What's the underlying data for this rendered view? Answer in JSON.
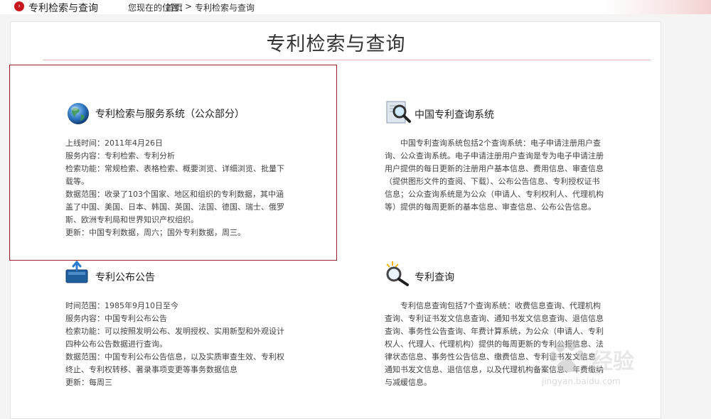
{
  "header": {
    "site_section": "专利检索与查询",
    "location_label": "您现在的位置：",
    "breadcrumb_home": "首页",
    "breadcrumb_sep": ">",
    "breadcrumb_current": "专利检索与查询"
  },
  "page": {
    "title": "专利检索与查询"
  },
  "cards": {
    "retrieval": {
      "title": "专利检索与服务系统（公众部分）",
      "lines": [
        "上线时间：2011年4月26日",
        "服务内容：专利检索、专利分析",
        "检索功能：常规检索、表格检索、概要浏览、详细浏览、批量下",
        "载等。",
        "数据范围：收录了103个国家、地区和组织的专利数据，其中涵",
        "盖了中国、美国、日本、韩国、英国、法国、德国、瑞士、俄罗",
        "斯、欧洲专利局和世界知识产权组织。",
        "更新：中国专利数据，周六；国外专利数据，周三。"
      ]
    },
    "china_query": {
      "title": "中国专利查询系统",
      "lines": [
        "中国专利查询系统包括2个查询系统：电子申请注册用户查",
        "询、公众查询系统。电子申请注册用户查询是专为电子申请注册",
        "用户提供的每日更新的注册用户基本信息、费用信息、审查信息",
        "（提供图形文件的查阅、下载）、公布公告信息、专利授权证书",
        "信息；公众查询系统是为公众（申请人、专利权利人、代理机构",
        "等）提供的每周更新的基本信息、审查信息、公布公告信息。"
      ]
    },
    "gazette": {
      "title": "专利公布公告",
      "lines": [
        "时间范围：1985年9月10日至今",
        "服务内容：中国专利公布公告",
        "检索功能：可以按照发明公布、发明授权、实用新型和外观设计",
        "四种公布公告数据进行查询。",
        "数据范围：中国专利公布公告信息，以及实质审查生效、专利权",
        "终止、专利权转移、著录事项变更等事务数据信息",
        "更新：每周三"
      ]
    },
    "query": {
      "title": "专利查询",
      "lines": [
        "专利信息查询包括7个查询系统：收费信息查询、代理机构",
        "查询、专利证书发文信息查询、通知书发文信息查询、退信信息",
        "查询、事务性公告查询、年费计算系统，为公众（申请人、专利",
        "权人、代理人、代理机构）提供的每周更新的专利公报信息、法",
        "律状态信息、事务性公告信息、缴费信息、专利证书发文信息",
        "通知书发文信息、退信信息，以及代理机构备案信息、年费缴纳",
        "与减缓信息。"
      ]
    }
  },
  "watermark": {
    "brand": "经验",
    "url": "jingyan.baidu.com"
  },
  "icons": {
    "globe": "globe-icon",
    "magnifier_doc": "magnifier-document-icon",
    "upload_box": "upload-box-icon",
    "magnifier_spark": "magnifier-sparkle-icon",
    "arrow": "arrow-right-icon"
  }
}
